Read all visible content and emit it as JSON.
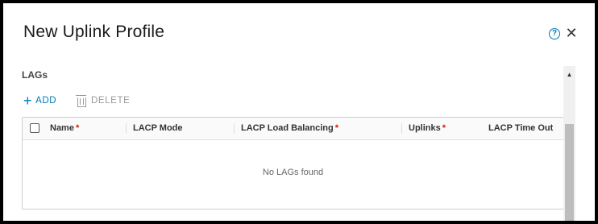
{
  "dialog": {
    "title": "New Uplink Profile",
    "help_icon": "question-circle-icon",
    "help_glyph": "?",
    "close_icon": "close-icon",
    "close_glyph": "✕"
  },
  "lags": {
    "section_title": "LAGs",
    "add_label": "ADD",
    "add_glyph": "+",
    "delete_label": "DELETE",
    "columns": [
      {
        "label": "Name",
        "required": true
      },
      {
        "label": "LACP Mode",
        "required": false
      },
      {
        "label": "LACP Load Balancing",
        "required": true
      },
      {
        "label": "Uplinks",
        "required": true
      },
      {
        "label": "LACP Time Out",
        "required": false
      }
    ],
    "required_mark": "*",
    "empty_text": "No LAGs found"
  },
  "scrollbar": {
    "up_glyph": "▲"
  },
  "colors": {
    "accent": "#0079b8",
    "required": "#c92100",
    "disabled": "#9a9a9a"
  }
}
